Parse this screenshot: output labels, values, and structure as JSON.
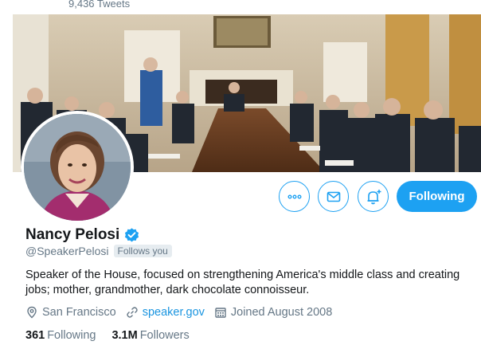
{
  "header": {
    "tweet_count": "9,436 Tweets"
  },
  "actions": {
    "more_icon": "more-horizontal-icon",
    "message_icon": "envelope-icon",
    "notify_icon": "bell-plus-icon",
    "follow_label": "Following"
  },
  "profile": {
    "display_name": "Nancy Pelosi",
    "handle": "@SpeakerPelosi",
    "follows_you": "Follows you",
    "bio": "Speaker of the House, focused on strengthening America's middle class and creating jobs; mother, grandmother, dark chocolate connoisseur.",
    "location": "San Francisco",
    "website": "speaker.gov",
    "joined": "Joined August 2008"
  },
  "stats": {
    "following_count": "361",
    "following_label": "Following",
    "followers_count": "3.1M",
    "followers_label": "Followers"
  },
  "colors": {
    "accent": "#1da1f2",
    "secondary_text": "#657786",
    "link": "#1b95e0"
  }
}
